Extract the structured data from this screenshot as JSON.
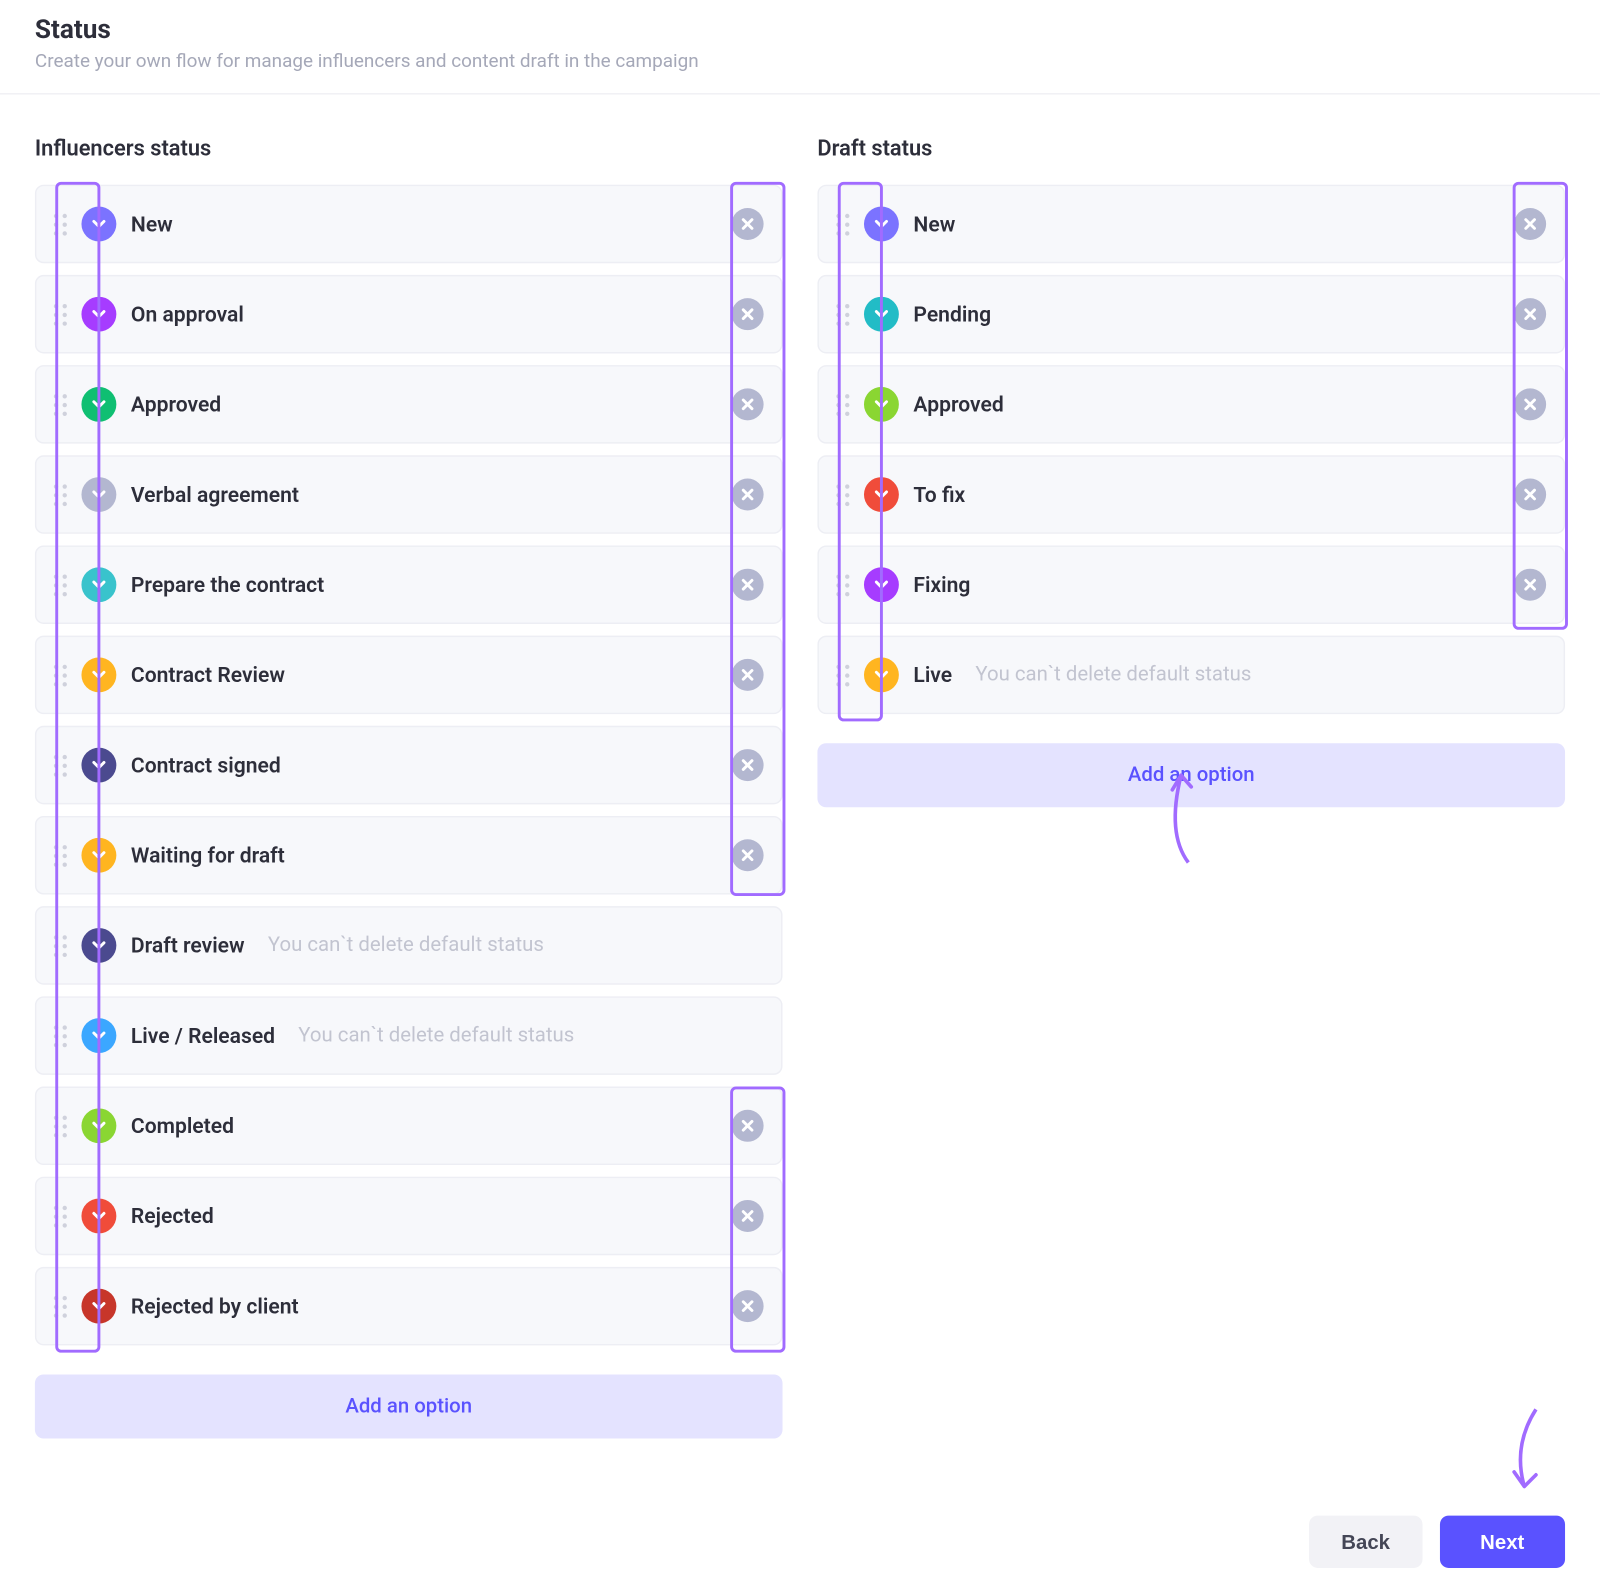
{
  "header": {
    "title": "Status",
    "subtitle": "Create your own flow for manage influencers and content draft in the campaign"
  },
  "columns": {
    "influencers": {
      "title": "Influencers status",
      "add_label": "Add an option",
      "items": [
        {
          "label": "New",
          "color": "#7b73ff",
          "deletable": true,
          "hint": ""
        },
        {
          "label": "On approval",
          "color": "#a63cff",
          "deletable": true,
          "hint": ""
        },
        {
          "label": "Approved",
          "color": "#0fbf72",
          "deletable": true,
          "hint": ""
        },
        {
          "label": "Verbal agreement",
          "color": "#b3b7d0",
          "deletable": true,
          "hint": ""
        },
        {
          "label": "Prepare the contract",
          "color": "#39c3cc",
          "deletable": true,
          "hint": ""
        },
        {
          "label": "Contract Review",
          "color": "#ffb520",
          "deletable": true,
          "hint": ""
        },
        {
          "label": "Contract signed",
          "color": "#4b4a8f",
          "deletable": true,
          "hint": ""
        },
        {
          "label": "Waiting for draft",
          "color": "#ffb520",
          "deletable": true,
          "hint": ""
        },
        {
          "label": "Draft review",
          "color": "#4b4a8f",
          "deletable": false,
          "hint": "You can`t delete default status"
        },
        {
          "label": "Live / Released",
          "color": "#3ba7ff",
          "deletable": false,
          "hint": "You can`t delete default status"
        },
        {
          "label": "Completed",
          "color": "#8ad632",
          "deletable": true,
          "hint": ""
        },
        {
          "label": "Rejected",
          "color": "#f04c3a",
          "deletable": true,
          "hint": ""
        },
        {
          "label": "Rejected by client",
          "color": "#c7362a",
          "deletable": true,
          "hint": ""
        }
      ]
    },
    "draft": {
      "title": "Draft status",
      "add_label": "Add an option",
      "items": [
        {
          "label": "New",
          "color": "#7b73ff",
          "deletable": true,
          "hint": ""
        },
        {
          "label": "Pending",
          "color": "#22bcc6",
          "deletable": true,
          "hint": ""
        },
        {
          "label": "Approved",
          "color": "#8ad632",
          "deletable": true,
          "hint": ""
        },
        {
          "label": "To fix",
          "color": "#f04c3a",
          "deletable": true,
          "hint": ""
        },
        {
          "label": "Fixing",
          "color": "#a63cff",
          "deletable": true,
          "hint": ""
        },
        {
          "label": "Live",
          "color": "#ffb520",
          "deletable": false,
          "hint": "You can`t delete default status"
        }
      ]
    }
  },
  "footer": {
    "back": "Back",
    "next": "Next"
  }
}
